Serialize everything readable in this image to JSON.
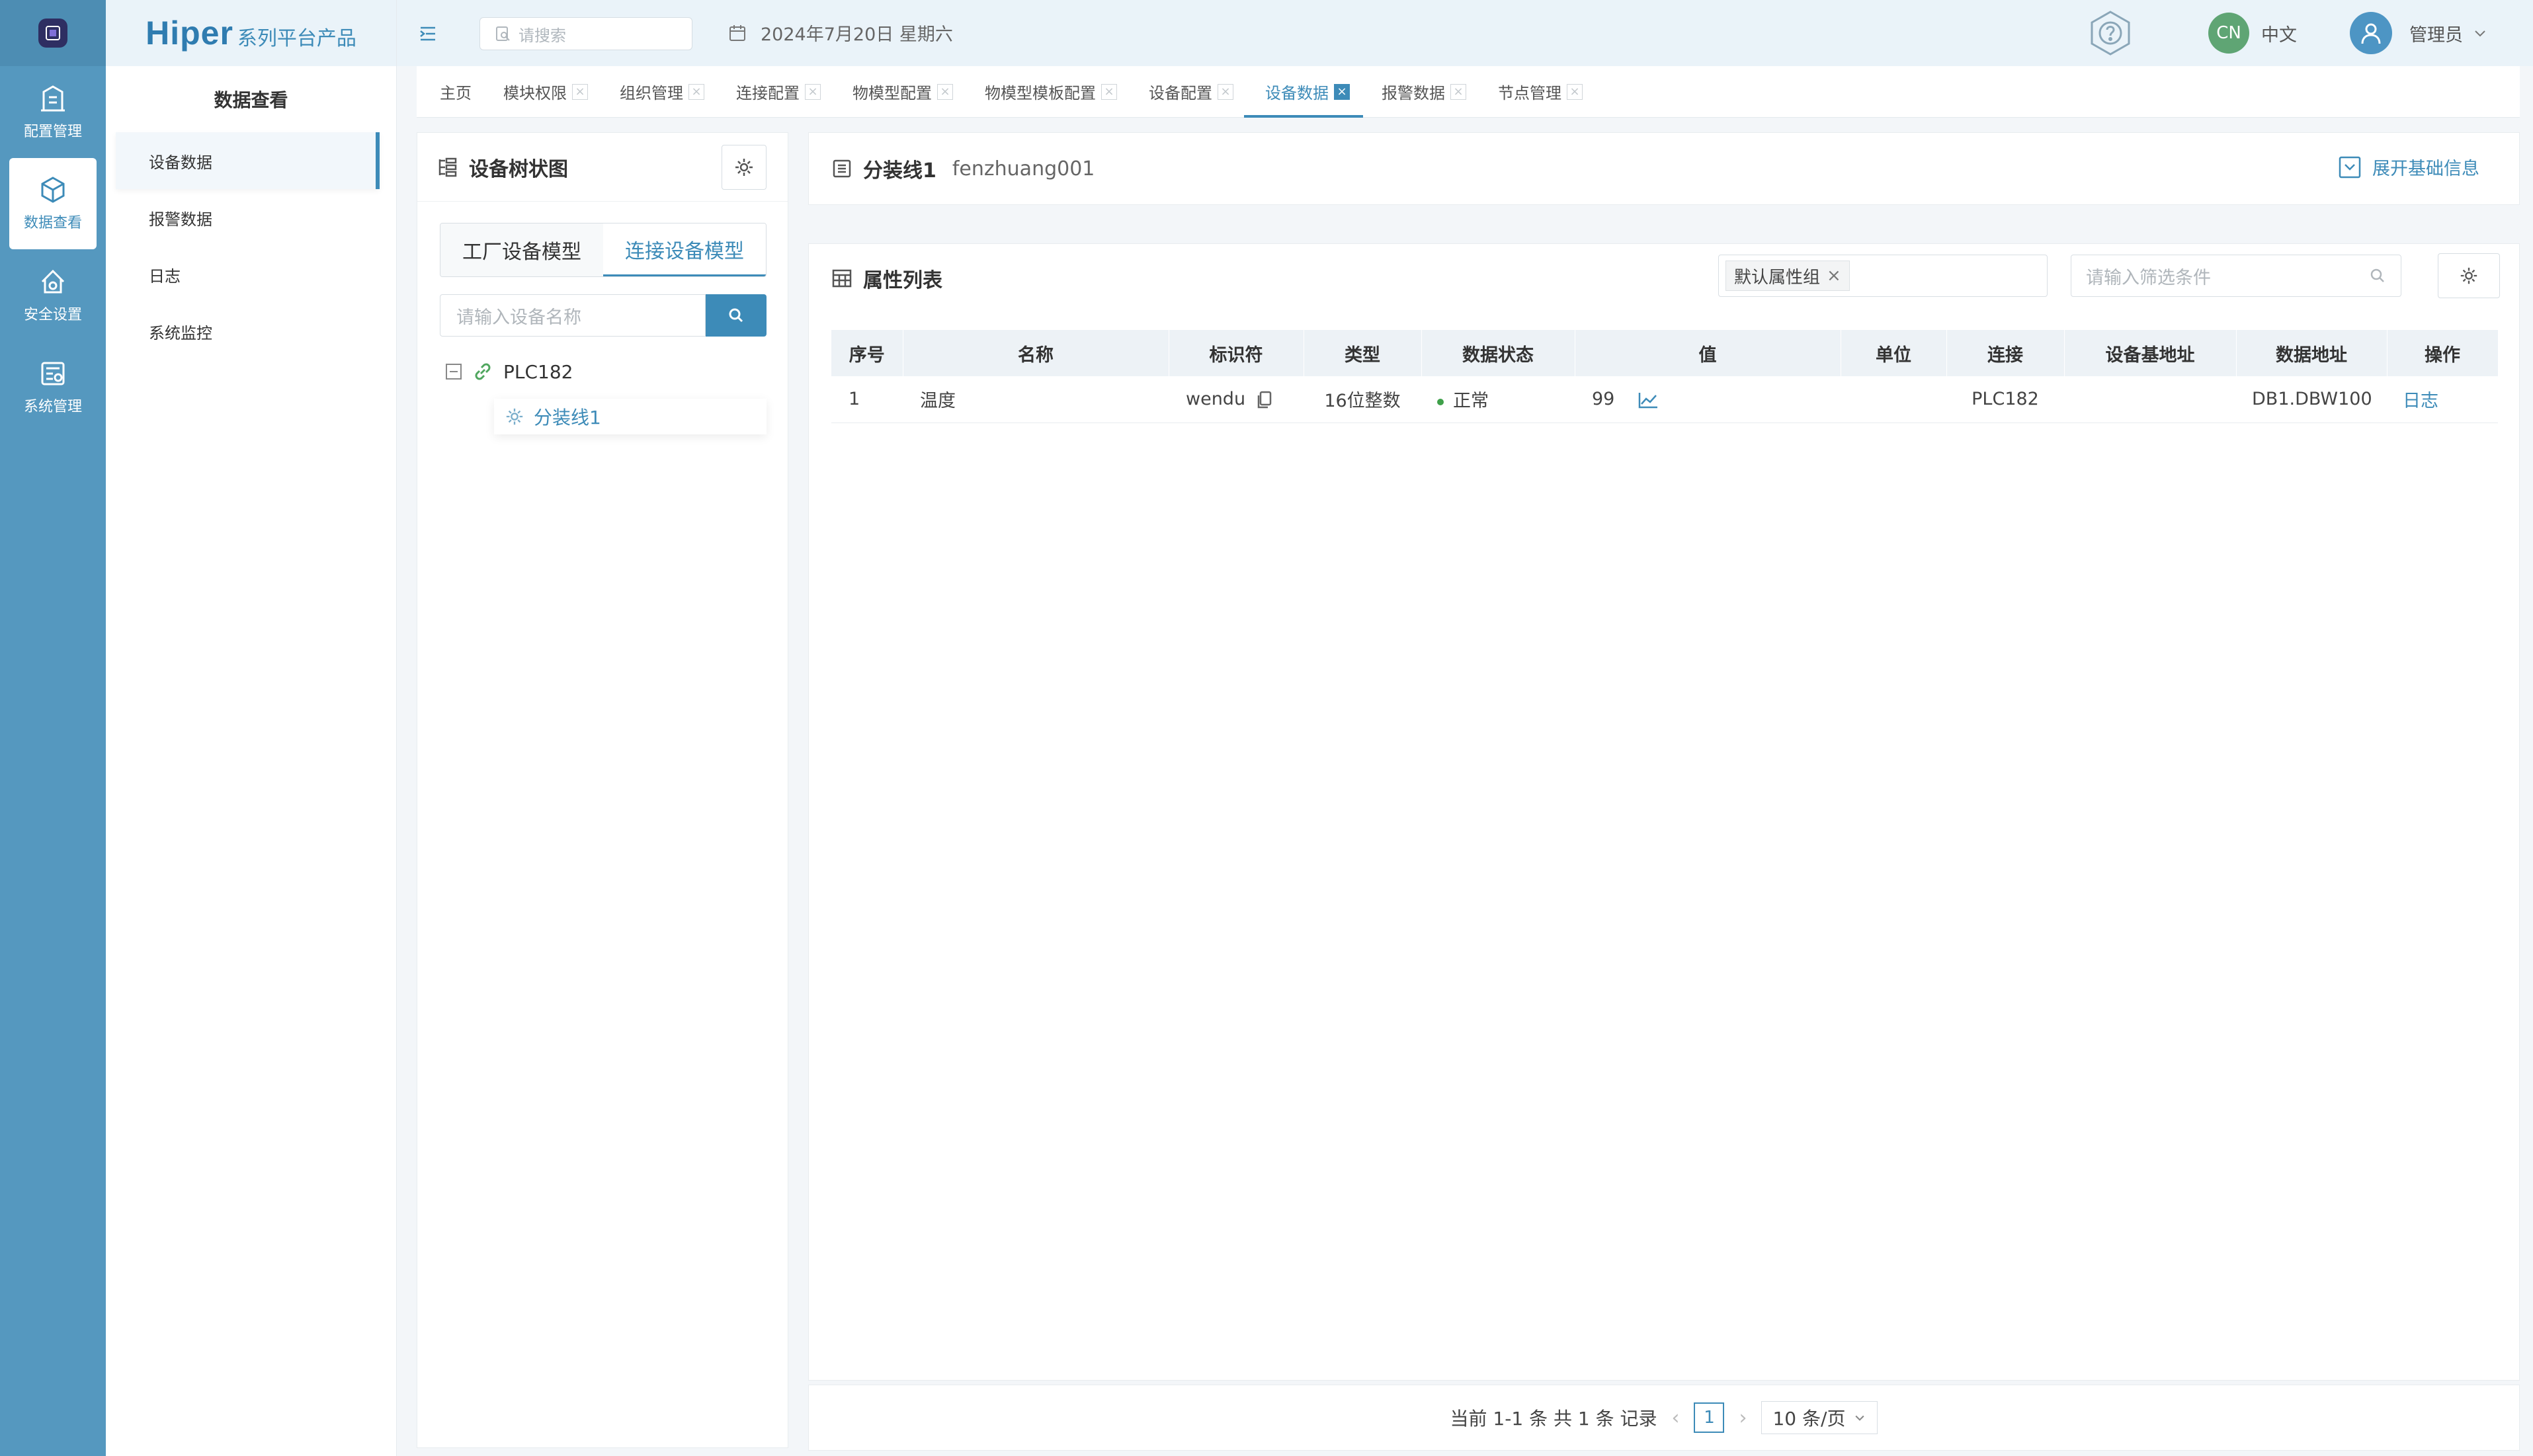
{
  "rail": {
    "items": [
      {
        "label": "配置管理",
        "icon": "building-icon"
      },
      {
        "label": "数据查看",
        "icon": "cube-icon"
      },
      {
        "label": "安全设置",
        "icon": "house-shield-icon"
      },
      {
        "label": "系统管理",
        "icon": "settings-panel-icon"
      }
    ],
    "active_index": 1
  },
  "brand": {
    "name": "Hiper",
    "suffix": "系列平台产品"
  },
  "menu": {
    "title": "数据查看",
    "items": [
      "设备数据",
      "报警数据",
      "日志",
      "系统监控"
    ]
  },
  "header": {
    "search_placeholder": "请搜索",
    "date": "2024年7月20日 星期六",
    "lang_badge": "CN",
    "lang_label": "中文",
    "user": "管理员"
  },
  "tabs": [
    "主页",
    "模块权限",
    "组织管理",
    "连接配置",
    "物模型配置",
    "物模型模板配置",
    "设备配置",
    "设备数据",
    "报警数据",
    "节点管理"
  ],
  "tree": {
    "title": "设备树状图",
    "seg_factory": "工厂设备模型",
    "seg_connect": "连接设备模型",
    "search_placeholder": "请输入设备名称",
    "root": "PLC182",
    "child": "分装线1"
  },
  "detail": {
    "name": "分装线1",
    "code": "fenzhuang001",
    "expand": "展开基础信息"
  },
  "attrs": {
    "title": "属性列表",
    "group_chip": "默认属性组",
    "filter_placeholder": "请输入筛选条件",
    "columns": [
      "序号",
      "名称",
      "标识符",
      "类型",
      "数据状态",
      "值",
      "单位",
      "连接",
      "设备基地址",
      "数据地址",
      "操作"
    ],
    "rows": [
      {
        "index": "1",
        "name": "温度",
        "identifier": "wendu",
        "type": "16位整数",
        "status": "正常",
        "value": "99",
        "unit": "",
        "connection": "PLC182",
        "base_address": "",
        "data_address": "DB1.DBW100",
        "action": "日志"
      }
    ]
  },
  "pager": {
    "summary": "当前 1-1 条 共 1 条 记录",
    "page": "1",
    "page_size": "10 条/页"
  },
  "colors": {
    "accent": "#3d8bb8",
    "rail": "#5598bf",
    "ok": "#3fa04a"
  }
}
